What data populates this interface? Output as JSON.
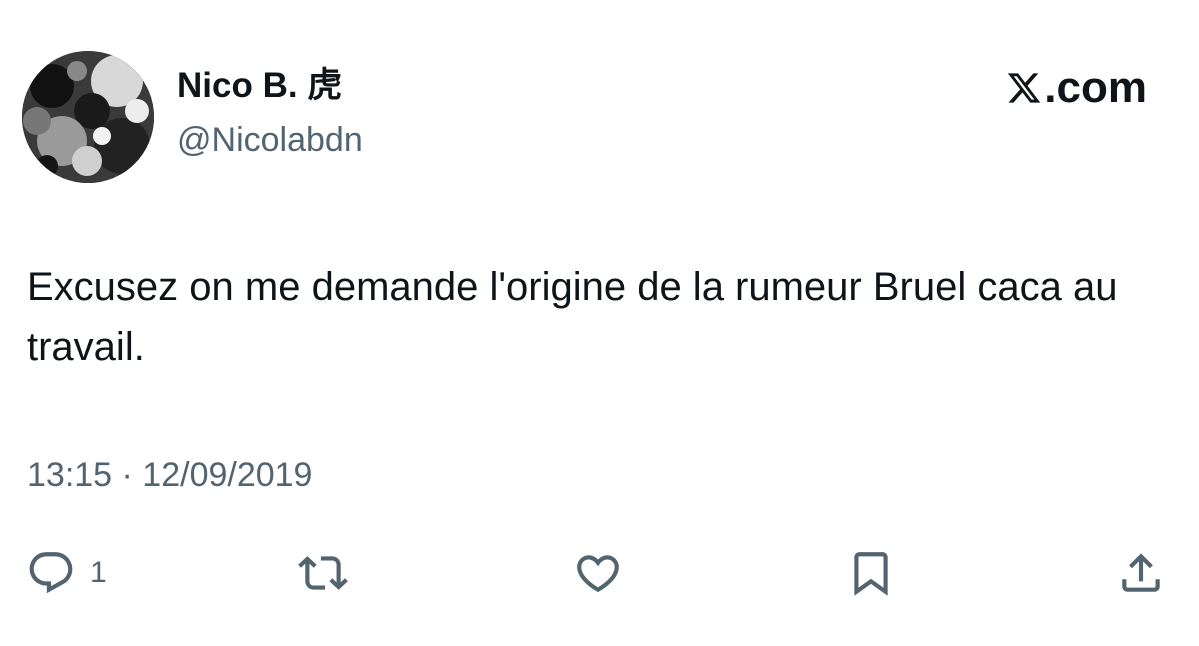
{
  "author": {
    "display_name": "Nico B. 虎",
    "handle": "@Nicolabdn"
  },
  "brand": {
    "logo_text": ".com",
    "logo_icon": "x-logo-icon"
  },
  "tweet": {
    "text": "Excusez on me demande l'origine de la rumeur Bruel caca au travail.",
    "timestamp": "13:15 · 12/09/2019"
  },
  "actions": {
    "reply": {
      "icon": "reply-icon",
      "count": "1"
    },
    "retweet": {
      "icon": "retweet-icon"
    },
    "like": {
      "icon": "heart-icon"
    },
    "bookmark": {
      "icon": "bookmark-icon"
    },
    "share": {
      "icon": "share-icon"
    }
  },
  "colors": {
    "text_primary": "#0f1419",
    "text_secondary": "#536471",
    "background": "#ffffff"
  }
}
